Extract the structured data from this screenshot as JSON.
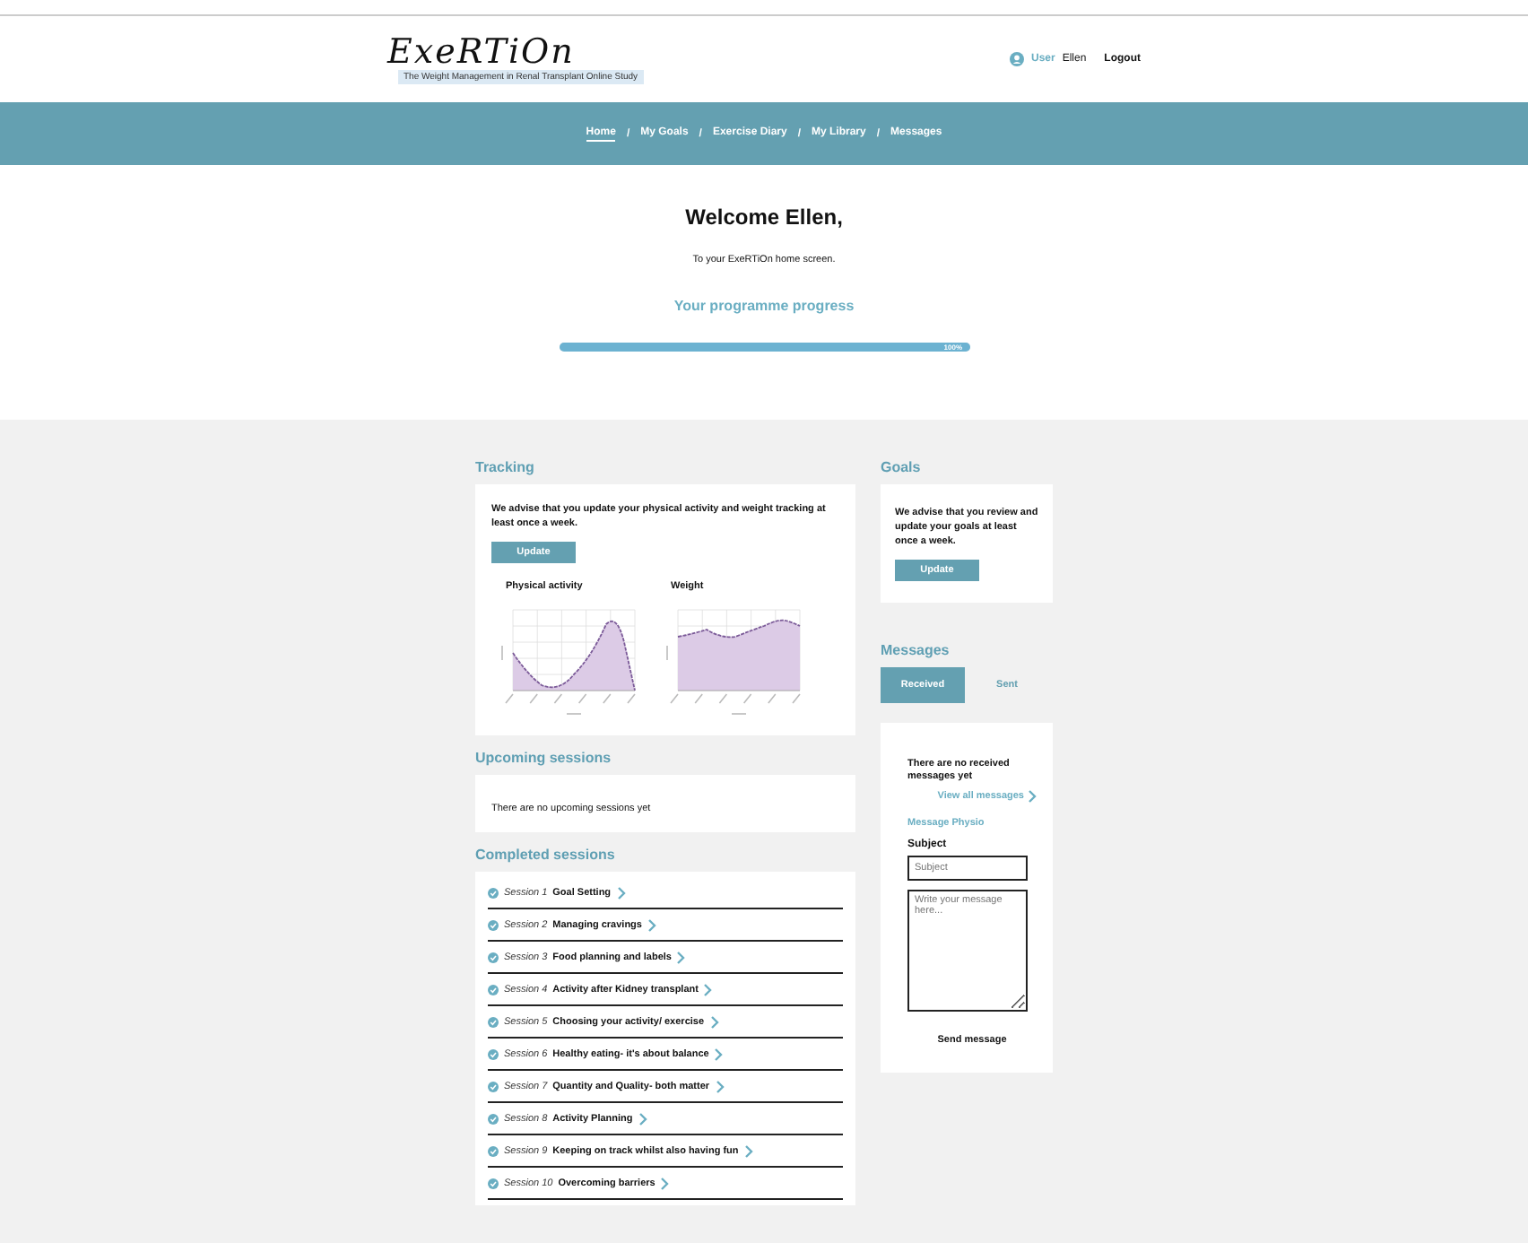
{
  "header": {
    "logo": "ExeRTiOn",
    "tagline": "The Weight Management in Renal Transplant Online Study",
    "user_prefix": "User",
    "user_name": "Ellen",
    "logout": "Logout"
  },
  "nav": {
    "separator": "/",
    "items": [
      {
        "label": "Home",
        "selected": true
      },
      {
        "label": "My Goals",
        "selected": false
      },
      {
        "label": "Exercise Diary",
        "selected": false
      },
      {
        "label": "My Library",
        "selected": false
      },
      {
        "label": "Messages",
        "selected": false
      }
    ]
  },
  "welcome": {
    "title": "Welcome Ellen,",
    "subtitle": "To your ExeRTiOn home screen.",
    "progress_title": "Your programme progress",
    "progress": {
      "level": 1,
      "reading": "100%"
    }
  },
  "tracking": {
    "title": "Tracking",
    "advice": "We advise that you update your physical activity and weight tracking at least once a week.",
    "button": "Update",
    "charts": [
      {
        "title": "Physical activity"
      },
      {
        "title": "Weight"
      }
    ]
  },
  "upcoming": {
    "title": "Upcoming sessions",
    "empty_text": "There are no upcoming sessions yet"
  },
  "completed": {
    "title": "Completed sessions",
    "sessions": [
      {
        "number": "Session 1",
        "name": "Goal Setting",
        "completed": true
      },
      {
        "number": "Session 2",
        "name": "Managing cravings",
        "completed": true
      },
      {
        "number": "Session 3",
        "name": "Food planning and labels",
        "completed": true
      },
      {
        "number": "Session 4",
        "name": "Activity after Kidney transplant",
        "completed": true
      },
      {
        "number": "Session 5",
        "name": "Choosing your activity/ exercise",
        "completed": true
      },
      {
        "number": "Session 6",
        "name": "Healthy eating- it's about balance",
        "completed": true
      },
      {
        "number": "Session 7",
        "name": "Quantity and Quality- both matter",
        "completed": true
      },
      {
        "number": "Session 8",
        "name": "Activity Planning",
        "completed": true
      },
      {
        "number": "Session 9",
        "name": "Keeping on track whilst also having fun",
        "completed": true
      },
      {
        "number": "Session 10",
        "name": "Overcoming barriers",
        "completed": true
      }
    ]
  },
  "goals": {
    "title": "Goals",
    "advice": "We advise that you review and update your goals at least once a week.",
    "button": "Update"
  },
  "messages": {
    "title": "Messages",
    "tabs": [
      {
        "label": "Received",
        "selected": true
      },
      {
        "label": "Sent",
        "selected": false
      }
    ],
    "empty_text": "There are no received messages yet",
    "view_all": "View all messages",
    "compose_title": "Message Physio",
    "subject_label": "Subject",
    "subject_placeholder": "Subject",
    "body_placeholder": "Write your message here...",
    "send": "Send message"
  }
}
